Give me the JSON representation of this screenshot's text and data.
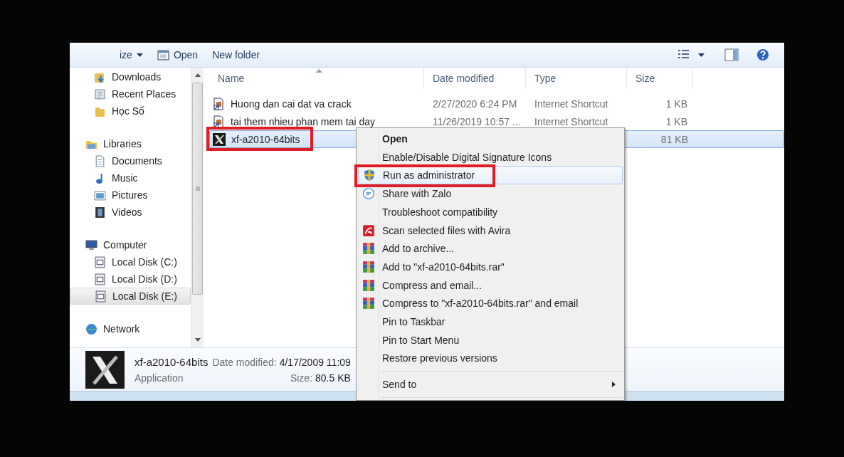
{
  "toolbar": {
    "organize": "ize",
    "open": "Open",
    "new_folder": "New folder"
  },
  "nav": {
    "groups": [
      {
        "children": [
          {
            "label": "Downloads",
            "selected": false
          },
          {
            "label": "Recent Places",
            "selected": false
          },
          {
            "label": "Học Số",
            "selected": false
          }
        ]
      },
      {
        "label": "Libraries",
        "children": [
          {
            "label": "Documents",
            "selected": false
          },
          {
            "label": "Music",
            "selected": false
          },
          {
            "label": "Pictures",
            "selected": false
          },
          {
            "label": "Videos",
            "selected": false
          }
        ]
      },
      {
        "label": "Computer",
        "children": [
          {
            "label": "Local Disk (C:)",
            "selected": false
          },
          {
            "label": "Local Disk (D:)",
            "selected": false
          },
          {
            "label": "Local Disk (E:)",
            "selected": true
          }
        ]
      },
      {
        "label": "Network"
      }
    ]
  },
  "files": {
    "columns": [
      "Name",
      "Date modified",
      "Type",
      "Size"
    ],
    "rows": [
      {
        "name": "Huong dan cai dat va crack",
        "date": "2/27/2020 6:24 PM",
        "type": "Internet Shortcut",
        "size": "1 KB",
        "kind": "shortcut",
        "selected": false,
        "annotated": false
      },
      {
        "name": "tai them nhieu phan mem tai day",
        "date": "11/26/2019 10:57 ...",
        "type": "Internet Shortcut",
        "size": "1 KB",
        "kind": "shortcut",
        "selected": false,
        "annotated": false
      },
      {
        "name": "xf-a2010-64bits",
        "size": "81 KB",
        "kind": "application",
        "selected": true,
        "annotated": true
      }
    ]
  },
  "context_menu": {
    "items": [
      {
        "kind": "plain",
        "label": "Open",
        "default": true,
        "selected": false,
        "submenu": false,
        "annotated": false
      },
      {
        "kind": "plain",
        "label": "Enable/Disable Digital Signature Icons",
        "default": false,
        "selected": false,
        "submenu": false,
        "annotated": false
      },
      {
        "kind": "shield",
        "label": "Run as administrator",
        "default": false,
        "selected": true,
        "submenu": false,
        "annotated": true
      },
      {
        "kind": "zalo",
        "label": "Share with Zalo",
        "default": false,
        "selected": false,
        "submenu": false,
        "annotated": false
      },
      {
        "kind": "plain",
        "label": "Troubleshoot compatibility",
        "default": false,
        "selected": false,
        "submenu": false,
        "annotated": false
      },
      {
        "kind": "avira",
        "label": "Scan selected files with Avira",
        "default": false,
        "selected": false,
        "submenu": false,
        "annotated": false
      },
      {
        "kind": "archive",
        "label": "Add to archive...",
        "default": false,
        "selected": false,
        "submenu": false,
        "annotated": false
      },
      {
        "kind": "archive",
        "label": "Add to \"xf-a2010-64bits.rar\"",
        "default": false,
        "selected": false,
        "submenu": false,
        "annotated": false
      },
      {
        "kind": "archive",
        "label": "Compress and email...",
        "default": false,
        "selected": false,
        "submenu": false,
        "annotated": false
      },
      {
        "kind": "archive",
        "label": "Compress to \"xf-a2010-64bits.rar\" and email",
        "default": false,
        "selected": false,
        "submenu": false,
        "annotated": false
      },
      {
        "kind": "plain",
        "label": "Pin to Taskbar",
        "default": false,
        "selected": false,
        "submenu": false,
        "annotated": false
      },
      {
        "kind": "plain",
        "label": "Pin to Start Menu",
        "default": false,
        "selected": false,
        "submenu": false,
        "annotated": false
      },
      {
        "kind": "plain",
        "label": "Restore previous versions",
        "default": false,
        "selected": false,
        "submenu": false,
        "annotated": false
      },
      {
        "kind": "separator"
      },
      {
        "kind": "plain",
        "label": "Send to",
        "default": false,
        "selected": false,
        "submenu": true,
        "annotated": false
      },
      {
        "kind": "separator"
      }
    ]
  },
  "details": {
    "name": "xf-a2010-64bits",
    "type": "Application",
    "date_label": "Date modified:",
    "date": "4/17/2009 11:09",
    "size_label": "Size:",
    "size": "80.5 KB"
  }
}
